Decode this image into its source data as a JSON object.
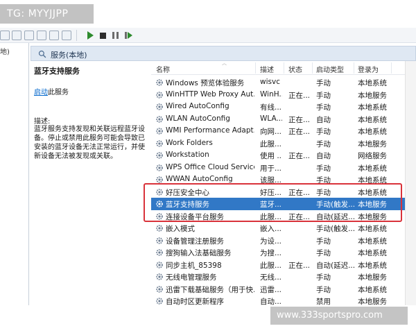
{
  "tag_label": "TG: MYYJJPP",
  "watermark": "www.333sportspro.com",
  "left_tree": {
    "label": "地)"
  },
  "pane": {
    "title": "服务(本地)"
  },
  "description": {
    "service_title": "蓝牙支持服务",
    "start_link": "启动",
    "start_suffix": "此服务",
    "label": "描述:",
    "text": "蓝牙服务支持发现和关联远程蓝牙设备。停止或禁用此服务可能会导致已安装的蓝牙设备无法正常运行，并使新设备无法被发现或关联。"
  },
  "columns": {
    "name": "名称",
    "description": "描述",
    "status": "状态",
    "startup": "启动类型",
    "logon": "登录为"
  },
  "services": [
    {
      "name": "Windows 预览体验服务",
      "desc": "wisvc",
      "status": "",
      "startup": "手动",
      "logon": "本地系统"
    },
    {
      "name": "WinHTTP Web Proxy Aut...",
      "desc": "WinH...",
      "status": "正在...",
      "startup": "手动",
      "logon": "本地服务"
    },
    {
      "name": "Wired AutoConfig",
      "desc": "有线...",
      "status": "",
      "startup": "手动",
      "logon": "本地系统"
    },
    {
      "name": "WLAN AutoConfig",
      "desc": "WLA...",
      "status": "正在...",
      "startup": "自动",
      "logon": "本地系统"
    },
    {
      "name": "WMI Performance Adapt...",
      "desc": "向网...",
      "status": "正在...",
      "startup": "手动",
      "logon": "本地系统"
    },
    {
      "name": "Work Folders",
      "desc": "此服...",
      "status": "",
      "startup": "手动",
      "logon": "本地服务"
    },
    {
      "name": "Workstation",
      "desc": "使用 ...",
      "status": "正在...",
      "startup": "自动",
      "logon": "网络服务"
    },
    {
      "name": "WPS Office Cloud Service",
      "desc": "用于...",
      "status": "",
      "startup": "手动",
      "logon": "本地系统"
    },
    {
      "name": "WWAN AutoConfig",
      "desc": "该服...",
      "status": "",
      "startup": "手动",
      "logon": "本地系统"
    },
    {
      "name": "好压安全中心",
      "desc": "好压...",
      "status": "正在...",
      "startup": "手动",
      "logon": "本地系统"
    },
    {
      "name": "蓝牙支持服务",
      "desc": "蓝牙...",
      "status": "",
      "startup": "手动(触发...",
      "logon": "本地服务",
      "selected": true
    },
    {
      "name": "连接设备平台服务",
      "desc": "此服...",
      "status": "正在...",
      "startup": "自动(延迟...",
      "logon": "本地服务"
    },
    {
      "name": "嵌入模式",
      "desc": "嵌入...",
      "status": "",
      "startup": "手动(触发...",
      "logon": "本地系统"
    },
    {
      "name": "设备管理注册服务",
      "desc": "为设...",
      "status": "",
      "startup": "手动",
      "logon": "本地系统"
    },
    {
      "name": "搜狗输入法基础服务",
      "desc": "为搜...",
      "status": "",
      "startup": "手动",
      "logon": "本地系统"
    },
    {
      "name": "同步主机_85398",
      "desc": "此服...",
      "status": "正在...",
      "startup": "自动(延迟...",
      "logon": "本地系统"
    },
    {
      "name": "无线电管理服务",
      "desc": "无线...",
      "status": "",
      "startup": "手动",
      "logon": "本地服务"
    },
    {
      "name": "迅雷下载基础服务（用于快...",
      "desc": "迅雷...",
      "status": "",
      "startup": "手动",
      "logon": "本地系统"
    },
    {
      "name": "自动时区更新程序",
      "desc": "自动...",
      "status": "",
      "startup": "禁用",
      "logon": "本地服务"
    }
  ]
}
